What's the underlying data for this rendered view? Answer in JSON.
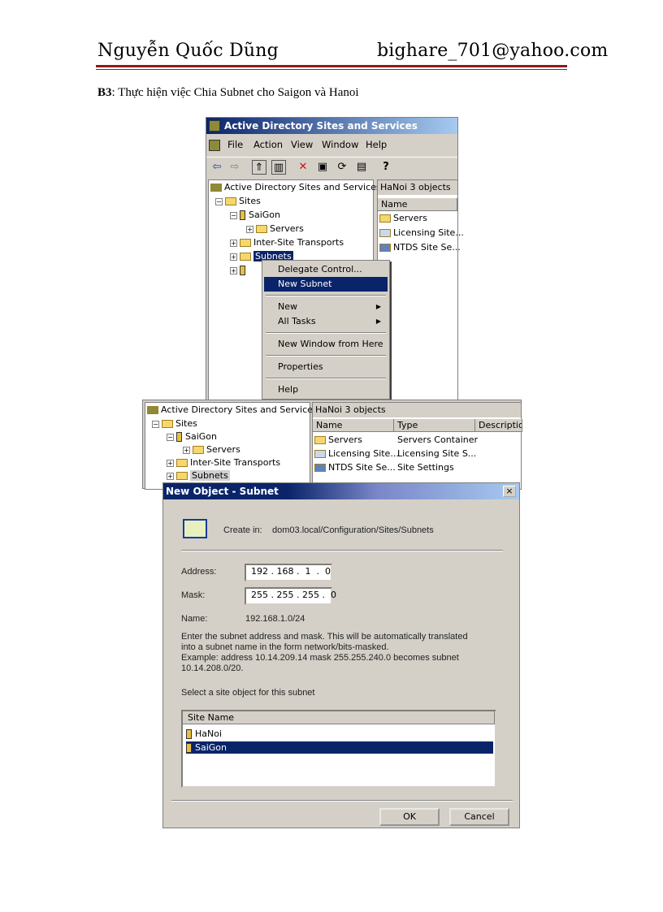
{
  "header": {
    "author": "Nguyễn Quốc Dũng",
    "email": "bighare_701@yahoo.com"
  },
  "step": {
    "label": "B3",
    "text": ": Thực hiện việc Chia Subnet cho Saigon và Hanoi"
  },
  "screenshot1": {
    "title": "Active Directory Sites and Services",
    "menu": [
      "File",
      "Action",
      "View",
      "Window",
      "Help"
    ],
    "tree": {
      "root": "Active Directory Sites and Services [",
      "sites": "Sites",
      "saigon": "SaiGon",
      "servers": "Servers",
      "inter_site": "Inter-Site Transports",
      "subnets": "Subnets"
    },
    "right_pane": {
      "header": "HaNoi   3 objects",
      "col_name": "Name",
      "items": [
        "Servers",
        "Licensing Site...",
        "NTDS Site Se..."
      ]
    },
    "context_menu": {
      "items": [
        "Delegate Control...",
        "New Subnet",
        "New",
        "All Tasks",
        "New Window from Here",
        "Properties",
        "Help"
      ],
      "selected": "New Subnet"
    }
  },
  "screenshot2": {
    "tree": {
      "root": "Active Directory Sites and Services [",
      "sites": "Sites",
      "saigon": "SaiGon",
      "servers": "Servers",
      "inter_site": "Inter-Site Transports",
      "subnets": "Subnets"
    },
    "right_pane": {
      "header": "HaNoi   3 objects",
      "columns": [
        "Name",
        "Type",
        "Description"
      ],
      "rows": [
        {
          "name": "Servers",
          "type": "Servers Container"
        },
        {
          "name": "Licensing Site...",
          "type": "Licensing Site S..."
        },
        {
          "name": "NTDS Site Se...",
          "type": "Site Settings"
        }
      ]
    },
    "dialog": {
      "title": "New Object - Subnet",
      "close": "×",
      "create_in_label": "Create in:",
      "create_in_value": "dom03.local/Configuration/Sites/Subnets",
      "address_label": "Address:",
      "address_value": "192 . 168 .  1  .  0",
      "mask_label": "Mask:",
      "mask_value": "255 . 255 . 255 .  0",
      "name_label": "Name:",
      "name_value": "192.168.1.0/24",
      "help_1": "Enter the subnet address and mask. This will be automatically translated",
      "help_2": "into a subnet name in the form network/bits-masked.",
      "help_3": "Example: address 10.14.209.14 mask 255.255.240.0 becomes subnet",
      "help_4": "10.14.208.0/20.",
      "select_label": "Select a site object for this subnet",
      "list_header": "Site Name",
      "sites": [
        "HaNoi",
        "SaiGon"
      ],
      "selected_site": "SaiGon",
      "ok": "OK",
      "cancel": "Cancel"
    }
  }
}
